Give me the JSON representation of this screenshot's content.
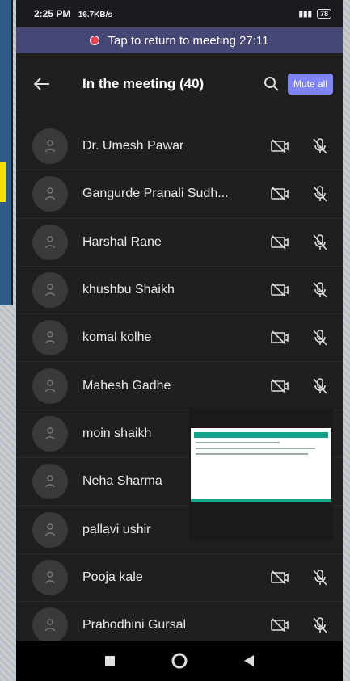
{
  "status_bar": {
    "time": "2:25 PM",
    "speed": "16.7KB/s",
    "battery": "78"
  },
  "banner": {
    "text": "Tap to return to meeting 27:11"
  },
  "header": {
    "title": "In the meeting (40)",
    "mute_all_label": "Mute all"
  },
  "participants": [
    "Dr. Umesh Pawar",
    "Gangurde Pranali Sudh...",
    "Harshal Rane",
    "khushbu Shaikh",
    "komal kolhe",
    "Mahesh Gadhe",
    "moin shaikh",
    "Neha Sharma",
    "pallavi ushir",
    "Pooja kale",
    "Prabodhini Gursal"
  ],
  "colors": {
    "banner": "#464775",
    "accent": "#7f85f5",
    "record_dot": "#e8455a"
  },
  "icons": [
    "back-arrow-icon",
    "search-icon",
    "camera-off-icon",
    "mic-off-icon",
    "person-icon"
  ]
}
